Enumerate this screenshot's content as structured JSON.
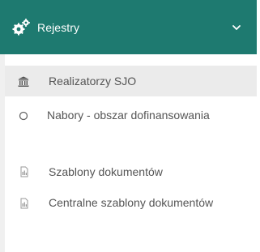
{
  "header": {
    "label": "Rejestry",
    "icon": "cogs-icon",
    "chevron": "chevron-down-icon",
    "background": "#1e7a70"
  },
  "menu": {
    "items": [
      {
        "label": "Realizatorzy SJO",
        "icon": "institution-icon",
        "active": true
      },
      {
        "label": "Nabory - obszar dofinansowania",
        "icon": "circle-outline-icon",
        "active": false
      },
      {
        "label": "Szablony dokumentów",
        "icon": "document-icon",
        "active": false
      },
      {
        "label": "Centralne szablony dokumentów",
        "icon": "document-icon",
        "active": false
      }
    ]
  }
}
